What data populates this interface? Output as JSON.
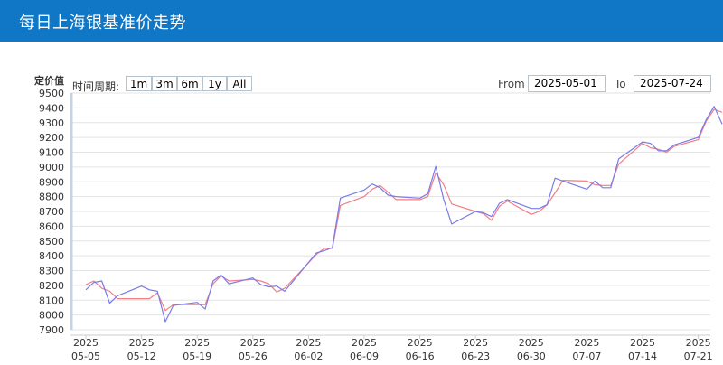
{
  "header": {
    "title": "每日上海银基准价走势"
  },
  "range_selector": {
    "label": "时间周期:",
    "buttons": [
      "1m",
      "3m",
      "6m",
      "1y",
      "All"
    ],
    "selected": "1m"
  },
  "date_range": {
    "from_label": "From",
    "from": "2025-05-01",
    "to_label": "To",
    "to": "2025-07-24"
  },
  "colors": {
    "header": "#0f77c5",
    "series_blue": "#7b7be6",
    "series_red": "#f07f86",
    "grid": "#e3e3e3"
  },
  "chart_data": {
    "type": "line",
    "ylabel": "定价值",
    "ylim": [
      7900,
      9500
    ],
    "yticks": [
      7900,
      8000,
      8100,
      8200,
      8300,
      8400,
      8500,
      8600,
      8700,
      8800,
      8900,
      9000,
      9100,
      9200,
      9300,
      9400,
      9500
    ],
    "xticks": [
      {
        "year": "2025",
        "date": "05-05"
      },
      {
        "year": "2025",
        "date": "05-12"
      },
      {
        "year": "2025",
        "date": "05-19"
      },
      {
        "year": "2025",
        "date": "05-26"
      },
      {
        "year": "2025",
        "date": "06-02"
      },
      {
        "year": "2025",
        "date": "06-09"
      },
      {
        "year": "2025",
        "date": "06-16"
      },
      {
        "year": "2025",
        "date": "06-23"
      },
      {
        "year": "2025",
        "date": "06-30"
      },
      {
        "year": "2025",
        "date": "07-07"
      },
      {
        "year": "2025",
        "date": "07-14"
      },
      {
        "year": "2025",
        "date": "07-21"
      }
    ],
    "grid": true,
    "series": [
      {
        "values": [
          [
            "2025-05-05",
            8170
          ],
          [
            "2025-05-06",
            8220
          ],
          [
            "2025-05-07",
            8230
          ],
          [
            "2025-05-08",
            8080
          ],
          [
            "2025-05-09",
            8130
          ],
          [
            "2025-05-12",
            8195
          ],
          [
            "2025-05-13",
            8170
          ],
          [
            "2025-05-14",
            8160
          ],
          [
            "2025-05-15",
            7955
          ],
          [
            "2025-05-16",
            8065
          ],
          [
            "2025-05-19",
            8085
          ],
          [
            "2025-05-20",
            8040
          ],
          [
            "2025-05-21",
            8230
          ],
          [
            "2025-05-22",
            8270
          ],
          [
            "2025-05-23",
            8210
          ],
          [
            "2025-05-26",
            8250
          ],
          [
            "2025-05-27",
            8205
          ],
          [
            "2025-05-28",
            8190
          ],
          [
            "2025-05-29",
            8195
          ],
          [
            "2025-05-30",
            8160
          ],
          [
            "2025-06-03",
            8420
          ],
          [
            "2025-06-04",
            8435
          ],
          [
            "2025-06-05",
            8455
          ],
          [
            "2025-06-06",
            8790
          ],
          [
            "2025-06-09",
            8845
          ],
          [
            "2025-06-10",
            8885
          ],
          [
            "2025-06-11",
            8860
          ],
          [
            "2025-06-12",
            8810
          ],
          [
            "2025-06-13",
            8800
          ],
          [
            "2025-06-16",
            8790
          ],
          [
            "2025-06-17",
            8820
          ],
          [
            "2025-06-18",
            9005
          ],
          [
            "2025-06-19",
            8780
          ],
          [
            "2025-06-20",
            8615
          ],
          [
            "2025-06-23",
            8700
          ],
          [
            "2025-06-24",
            8690
          ],
          [
            "2025-06-25",
            8665
          ],
          [
            "2025-06-26",
            8755
          ],
          [
            "2025-06-27",
            8780
          ],
          [
            "2025-06-30",
            8720
          ],
          [
            "2025-07-01",
            8720
          ],
          [
            "2025-07-02",
            8745
          ],
          [
            "2025-07-03",
            8925
          ],
          [
            "2025-07-04",
            8905
          ],
          [
            "2025-07-07",
            8850
          ],
          [
            "2025-07-08",
            8905
          ],
          [
            "2025-07-09",
            8860
          ],
          [
            "2025-07-10",
            8860
          ],
          [
            "2025-07-11",
            9055
          ],
          [
            "2025-07-14",
            9170
          ],
          [
            "2025-07-15",
            9160
          ],
          [
            "2025-07-16",
            9110
          ],
          [
            "2025-07-17",
            9110
          ],
          [
            "2025-07-18",
            9150
          ],
          [
            "2025-07-21",
            9200
          ],
          [
            "2025-07-22",
            9320
          ],
          [
            "2025-07-23",
            9410
          ],
          [
            "2025-07-24",
            9290
          ]
        ]
      },
      {
        "values": [
          [
            "2025-05-05",
            8205
          ],
          [
            "2025-05-06",
            8230
          ],
          [
            "2025-05-07",
            8180
          ],
          [
            "2025-05-08",
            8160
          ],
          [
            "2025-05-09",
            8110
          ],
          [
            "2025-05-12",
            8110
          ],
          [
            "2025-05-13",
            8110
          ],
          [
            "2025-05-14",
            8150
          ],
          [
            "2025-05-15",
            8030
          ],
          [
            "2025-05-16",
            8070
          ],
          [
            "2025-05-19",
            8070
          ],
          [
            "2025-05-20",
            8070
          ],
          [
            "2025-05-21",
            8210
          ],
          [
            "2025-05-22",
            8265
          ],
          [
            "2025-05-23",
            8230
          ],
          [
            "2025-05-26",
            8240
          ],
          [
            "2025-05-27",
            8230
          ],
          [
            "2025-05-28",
            8210
          ],
          [
            "2025-05-29",
            8155
          ],
          [
            "2025-05-30",
            8180
          ],
          [
            "2025-06-03",
            8410
          ],
          [
            "2025-06-04",
            8450
          ],
          [
            "2025-06-05",
            8450
          ],
          [
            "2025-06-06",
            8740
          ],
          [
            "2025-06-09",
            8800
          ],
          [
            "2025-06-10",
            8850
          ],
          [
            "2025-06-11",
            8875
          ],
          [
            "2025-06-12",
            8830
          ],
          [
            "2025-06-13",
            8780
          ],
          [
            "2025-06-16",
            8780
          ],
          [
            "2025-06-17",
            8800
          ],
          [
            "2025-06-18",
            8960
          ],
          [
            "2025-06-19",
            8880
          ],
          [
            "2025-06-20",
            8750
          ],
          [
            "2025-06-23",
            8700
          ],
          [
            "2025-06-24",
            8685
          ],
          [
            "2025-06-25",
            8640
          ],
          [
            "2025-06-26",
            8735
          ],
          [
            "2025-06-27",
            8770
          ],
          [
            "2025-06-30",
            8680
          ],
          [
            "2025-07-01",
            8700
          ],
          [
            "2025-07-02",
            8745
          ],
          [
            "2025-07-03",
            8825
          ],
          [
            "2025-07-04",
            8910
          ],
          [
            "2025-07-07",
            8905
          ],
          [
            "2025-07-08",
            8880
          ],
          [
            "2025-07-09",
            8875
          ],
          [
            "2025-07-10",
            8875
          ],
          [
            "2025-07-11",
            9020
          ],
          [
            "2025-07-14",
            9160
          ],
          [
            "2025-07-15",
            9130
          ],
          [
            "2025-07-16",
            9120
          ],
          [
            "2025-07-17",
            9100
          ],
          [
            "2025-07-18",
            9140
          ],
          [
            "2025-07-21",
            9185
          ],
          [
            "2025-07-22",
            9310
          ],
          [
            "2025-07-23",
            9390
          ],
          [
            "2025-07-24",
            9370
          ]
        ]
      }
    ]
  }
}
